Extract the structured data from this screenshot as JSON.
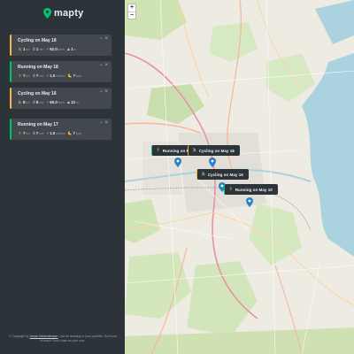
{
  "app": {
    "name": "mapty"
  },
  "workouts": [
    {
      "type": "cycling",
      "title": "Cycling on May 18",
      "details": [
        {
          "icon": "bicycle-icon",
          "value": "1",
          "unit": "km"
        },
        {
          "icon": "clock-icon",
          "value": "1",
          "unit": "min"
        },
        {
          "icon": "bolt-icon",
          "value": "62.0",
          "unit": "km/h"
        },
        {
          "icon": "mountain-icon",
          "value": "1",
          "unit": "m"
        }
      ]
    },
    {
      "type": "running",
      "title": "Running on May 18",
      "details": [
        {
          "icon": "runner-icon",
          "value": "7",
          "unit": "km"
        },
        {
          "icon": "clock-icon",
          "value": "7",
          "unit": "min"
        },
        {
          "icon": "bolt-icon",
          "value": "1.0",
          "unit": "min/km"
        },
        {
          "icon": "footprint-icon",
          "value": "7",
          "unit": "spm"
        }
      ]
    },
    {
      "type": "cycling",
      "title": "Cycling on May 16",
      "details": [
        {
          "icon": "bicycle-icon",
          "value": "8",
          "unit": "km"
        },
        {
          "icon": "clock-icon",
          "value": "8",
          "unit": "min"
        },
        {
          "icon": "bolt-icon",
          "value": "60.0",
          "unit": "km/h"
        },
        {
          "icon": "mountain-icon",
          "value": "12",
          "unit": "m"
        }
      ]
    },
    {
      "type": "running",
      "title": "Running on May 17",
      "details": [
        {
          "icon": "runner-icon",
          "value": "7",
          "unit": "km"
        },
        {
          "icon": "clock-icon",
          "value": "7",
          "unit": "min"
        },
        {
          "icon": "bolt-icon",
          "value": "1.0",
          "unit": "min/km"
        },
        {
          "icon": "footprint-icon",
          "value": "7",
          "unit": "spm"
        }
      ]
    }
  ],
  "controls": {
    "edit": "−",
    "delete": "×"
  },
  "copyright": {
    "prefix": "© Copyright by ",
    "author": "Jonas Schmedtmann",
    "suffix": ". Use for learning or your portfolio. Don't use to teach. Don't claim as your own."
  },
  "map": {
    "zoom_in": "+",
    "zoom_out": "−",
    "popups": [
      {
        "type": "running",
        "label": "Running on May 18"
      },
      {
        "type": "cycling",
        "label": "Cycling on May 18"
      },
      {
        "type": "cycling",
        "label": "Cycling on May 16"
      },
      {
        "type": "running",
        "label": "Running on May 10"
      }
    ]
  },
  "colors": {
    "cycling": "#ffb545",
    "running": "#00c46a",
    "sidebar": "#2d3439",
    "card": "#42484d"
  }
}
